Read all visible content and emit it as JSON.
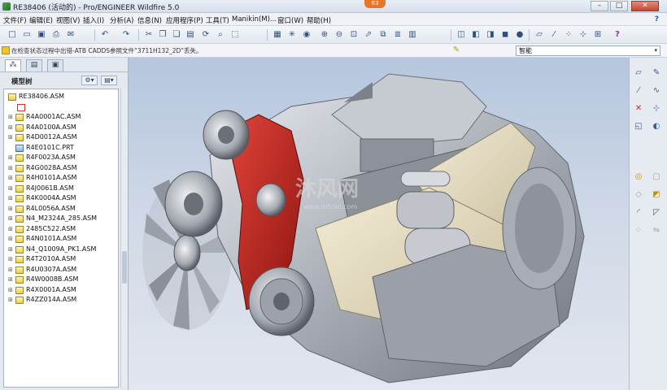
{
  "window": {
    "title": "RE38406 (活动的) - Pro/ENGINEER Wildfire 5.0",
    "badge": "83",
    "minimize": "–",
    "maximize": "□",
    "close": "✕"
  },
  "menu": {
    "items": [
      "文件(F)",
      "编辑(E)",
      "视图(V)",
      "插入(I)",
      "分析(A)",
      "信息(N)",
      "应用程序(P)",
      "工具(T)",
      "Manikin(M)...",
      "窗口(W)",
      "帮助(H)"
    ],
    "help_icon": "?"
  },
  "toolbar": {
    "buttons": [
      {
        "icon": "new-icon",
        "glyph": "□"
      },
      {
        "icon": "open-icon",
        "glyph": "▭"
      },
      {
        "icon": "save-icon",
        "glyph": "▣"
      },
      {
        "icon": "print-icon",
        "glyph": "⎙"
      },
      {
        "icon": "send-icon",
        "glyph": "✉"
      },
      {
        "icon": "undo-icon",
        "glyph": "↶"
      },
      {
        "icon": "redo-icon",
        "glyph": "↷"
      },
      {
        "icon": "cut-icon",
        "glyph": "✂"
      },
      {
        "icon": "copy-icon",
        "glyph": "❐"
      },
      {
        "icon": "paste-icon",
        "glyph": "❏"
      },
      {
        "icon": "paste-special-icon",
        "glyph": "▤"
      },
      {
        "icon": "regenerate-icon",
        "glyph": "⟳"
      },
      {
        "icon": "find-icon",
        "glyph": "⌕"
      },
      {
        "icon": "select-box-icon",
        "glyph": "⬚"
      },
      {
        "icon": "repaint-icon",
        "glyph": "▦"
      },
      {
        "icon": "spin-center-icon",
        "glyph": "✳"
      },
      {
        "icon": "orient-mode-icon",
        "glyph": "◉"
      },
      {
        "icon": "zoom-in-icon",
        "glyph": "⊕"
      },
      {
        "icon": "zoom-out-icon",
        "glyph": "⊖"
      },
      {
        "icon": "refit-icon",
        "glyph": "⊡"
      },
      {
        "icon": "reorient-icon",
        "glyph": "⬀"
      },
      {
        "icon": "saved-views-icon",
        "glyph": "⧉"
      },
      {
        "icon": "layers-icon",
        "glyph": "≣"
      },
      {
        "icon": "view-manager-icon",
        "glyph": "▥"
      },
      {
        "icon": "wireframe-icon",
        "glyph": "◫"
      },
      {
        "icon": "hidden-line-icon",
        "glyph": "◧"
      },
      {
        "icon": "no-hidden-icon",
        "glyph": "◨"
      },
      {
        "icon": "shading-icon",
        "glyph": "◼"
      },
      {
        "icon": "enhanced-realism-icon",
        "glyph": "●"
      },
      {
        "icon": "datum-planes-icon",
        "glyph": "▱"
      },
      {
        "icon": "datum-axes-icon",
        "glyph": "⁄"
      },
      {
        "icon": "point-display-icon",
        "glyph": "⁘"
      },
      {
        "icon": "csys-display-icon",
        "glyph": "⊹"
      },
      {
        "icon": "annotation-display-icon",
        "glyph": "⊞"
      },
      {
        "icon": "context-help-icon",
        "glyph": "?"
      }
    ]
  },
  "message": {
    "text": "在检查状态过程中出错-ATB CADDS参照文件“3711H132_2D”丢失。",
    "select_value": "智能",
    "select_arrow": "▾",
    "pin_glyph": "✎"
  },
  "left_panel": {
    "tabs": [
      {
        "icon": "model-tree-tab-icon",
        "glyph": "⁂"
      },
      {
        "icon": "folder-browser-tab-icon",
        "glyph": "▤"
      },
      {
        "icon": "favorites-tab-icon",
        "glyph": "▣"
      }
    ],
    "title": "模型树",
    "settings_glyph": "⚙▾",
    "show_glyph": "▤▾",
    "tree": [
      {
        "label": "RE38406.ASM",
        "type": "root",
        "expander": ""
      },
      {
        "label": "",
        "type": "sub",
        "expander": ""
      },
      {
        "label": "R4A0001AC.ASM",
        "type": "asm",
        "expander": "⊞"
      },
      {
        "label": "R4A0100A.ASM",
        "type": "asm",
        "expander": "⊞"
      },
      {
        "label": "R4D0012A.ASM",
        "type": "asm",
        "expander": "⊞"
      },
      {
        "label": "R4E0101C.PRT",
        "type": "prt",
        "expander": ""
      },
      {
        "label": "R4F0023A.ASM",
        "type": "asm",
        "expander": "⊞"
      },
      {
        "label": "R4G0028A.ASM",
        "type": "asm",
        "expander": "⊞"
      },
      {
        "label": "R4H0101A.ASM",
        "type": "asm",
        "expander": "⊞"
      },
      {
        "label": "R4J0061B.ASM",
        "type": "asm",
        "expander": "⊞"
      },
      {
        "label": "R4K0004A.ASM",
        "type": "asm",
        "expander": "⊞"
      },
      {
        "label": "R4L0056A.ASM",
        "type": "asm",
        "expander": "⊞"
      },
      {
        "label": "N4_M2324A_285.ASM",
        "type": "asm",
        "expander": "⊞"
      },
      {
        "label": "2485C522.ASM",
        "type": "asm",
        "expander": "⊞"
      },
      {
        "label": "R4N0101A.ASM",
        "type": "asm",
        "expander": "⊞"
      },
      {
        "label": "N4_Q1009A_PK1.ASM",
        "type": "asm",
        "expander": "⊞"
      },
      {
        "label": "R4T2010A.ASM",
        "type": "asm",
        "expander": "⊞"
      },
      {
        "label": "R4U0307A.ASM",
        "type": "asm",
        "expander": "⊞"
      },
      {
        "label": "R4W0008B.ASM",
        "type": "asm",
        "expander": "⊞"
      },
      {
        "label": "R4X0001A.ASM",
        "type": "asm",
        "expander": "⊞"
      },
      {
        "label": "R4ZZ014A.ASM",
        "type": "asm",
        "expander": "⊞"
      }
    ]
  },
  "viewport": {
    "watermark": "沐风网",
    "watermark_url": "www.mfcad.com",
    "colors": {
      "body": "#b9bec6",
      "cover": "#c0281e",
      "housing": "#e8e0c8",
      "dark": "#55585e"
    }
  },
  "right_toolbar": {
    "buttons": [
      {
        "icon": "datum-plane-icon",
        "glyph": "▱",
        "tone": ""
      },
      {
        "icon": "sketch-icon",
        "glyph": "✎",
        "tone": ""
      },
      {
        "icon": "axis-icon",
        "glyph": "⁄",
        "tone": ""
      },
      {
        "icon": "curve-icon",
        "glyph": "∿",
        "tone": ""
      },
      {
        "icon": "point-icon",
        "glyph": "✕",
        "tone": "red"
      },
      {
        "icon": "csys-icon",
        "glyph": "⊹",
        "tone": ""
      },
      {
        "icon": "extrude-icon",
        "glyph": "◱",
        "tone": ""
      },
      {
        "icon": "revolve-icon",
        "glyph": "◐",
        "tone": ""
      },
      {
        "icon": "hole-icon",
        "glyph": "◎",
        "tone": "yellow"
      },
      {
        "icon": "shell-icon",
        "glyph": "▢",
        "tone": "gray"
      },
      {
        "icon": "rib-icon",
        "glyph": "◇",
        "tone": "gray"
      },
      {
        "icon": "draft-icon",
        "glyph": "◩",
        "tone": "yellow"
      },
      {
        "icon": "round-icon",
        "glyph": "◜",
        "tone": ""
      },
      {
        "icon": "chamfer-icon",
        "glyph": "◸",
        "tone": ""
      },
      {
        "icon": "pattern-icon",
        "glyph": "⁘",
        "tone": "gray"
      },
      {
        "icon": "mirror-icon",
        "glyph": "⇋",
        "tone": "gray"
      }
    ]
  }
}
